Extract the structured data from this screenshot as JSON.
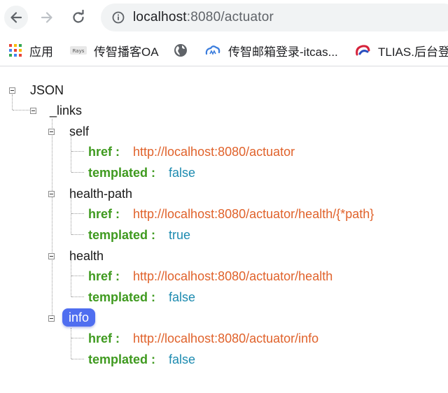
{
  "browser": {
    "url_host": "localhost",
    "url_rest": ":8080/actuator",
    "bookmarks": [
      {
        "label": "应用",
        "icon": "apps-grid-icon"
      },
      {
        "label": "传智播客OA",
        "icon": "rays-logo-icon"
      },
      {
        "label": "",
        "icon": "globe-icon"
      },
      {
        "label": "传智邮箱登录-itcas...",
        "icon": "cloud-mail-icon"
      },
      {
        "label": "TLIAS.后台登",
        "icon": "tlias-logo-icon"
      }
    ]
  },
  "tree": {
    "root_label": "JSON",
    "links_label": "_links",
    "entries": [
      {
        "name": "self",
        "href_key": "href :",
        "href": "http://localhost:8080/actuator",
        "templated_key": "templated :",
        "templated": "false"
      },
      {
        "name": "health-path",
        "href_key": "href :",
        "href": "http://localhost:8080/actuator/health/{*path}",
        "templated_key": "templated :",
        "templated": "true"
      },
      {
        "name": "health",
        "href_key": "href :",
        "href": "http://localhost:8080/actuator/health",
        "templated_key": "templated :",
        "templated": "false"
      },
      {
        "name": "info",
        "href_key": "href :",
        "href": "http://localhost:8080/actuator/info",
        "templated_key": "templated :",
        "templated": "false",
        "selected": true
      }
    ]
  },
  "colors": {
    "key": "#3f9a1f",
    "string": "#e0622b",
    "boolean": "#1d8bb0",
    "selection": "#4f6ef0"
  }
}
